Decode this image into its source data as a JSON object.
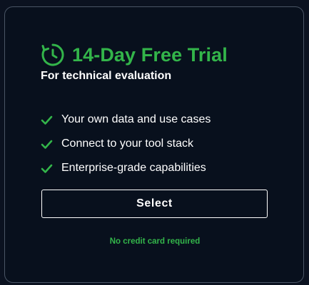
{
  "card": {
    "title": "14-Day Free Trial",
    "title_icon": "clock-refresh-icon",
    "subtitle": "For technical evaluation",
    "features": [
      {
        "label": "Your own data and use cases",
        "icon": "check-icon"
      },
      {
        "label": "Connect to your tool stack",
        "icon": "check-icon"
      },
      {
        "label": "Enterprise-grade capabilities",
        "icon": "check-icon"
      }
    ],
    "button_label": "Select",
    "note": "No credit card required"
  },
  "colors": {
    "background": "#08101d",
    "accent": "#33b54a",
    "border": "#4a5565",
    "text": "#ffffff"
  }
}
